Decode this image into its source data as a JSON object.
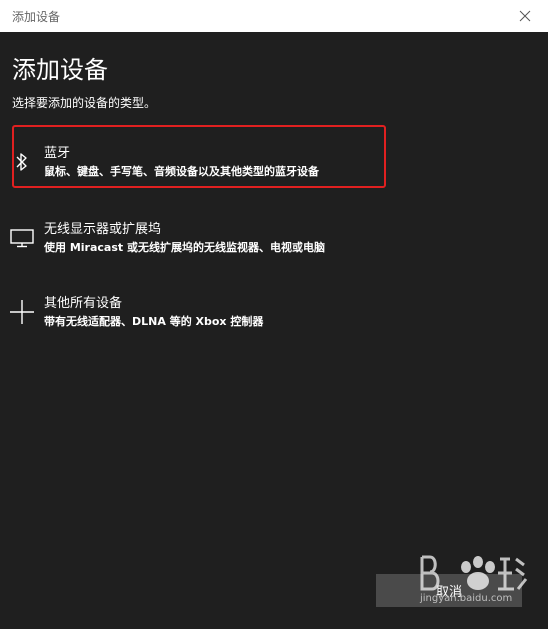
{
  "window": {
    "title": "添加设备"
  },
  "page": {
    "title": "添加设备",
    "subtitle": "选择要添加的设备的类型。"
  },
  "options": [
    {
      "icon": "bluetooth-icon",
      "name": "蓝牙",
      "description": "鼠标、键盘、手写笔、音频设备以及其他类型的蓝牙设备",
      "highlighted": true
    },
    {
      "icon": "monitor-icon",
      "name": "无线显示器或扩展坞",
      "description": "使用 Miracast 或无线扩展坞的无线监视器、电视或电脑"
    },
    {
      "icon": "plus-icon",
      "name": "其他所有设备",
      "description": "带有无线适配器、DLNA 等的 Xbox 控制器"
    }
  ],
  "footer": {
    "cancel_label": "取消"
  },
  "watermark": {
    "site": "jingyan.baidu.com"
  },
  "colors": {
    "background": "#1f1f1f",
    "titlebar": "#ffffff",
    "highlight_border": "#e02020",
    "button": "#4a4a4a"
  }
}
